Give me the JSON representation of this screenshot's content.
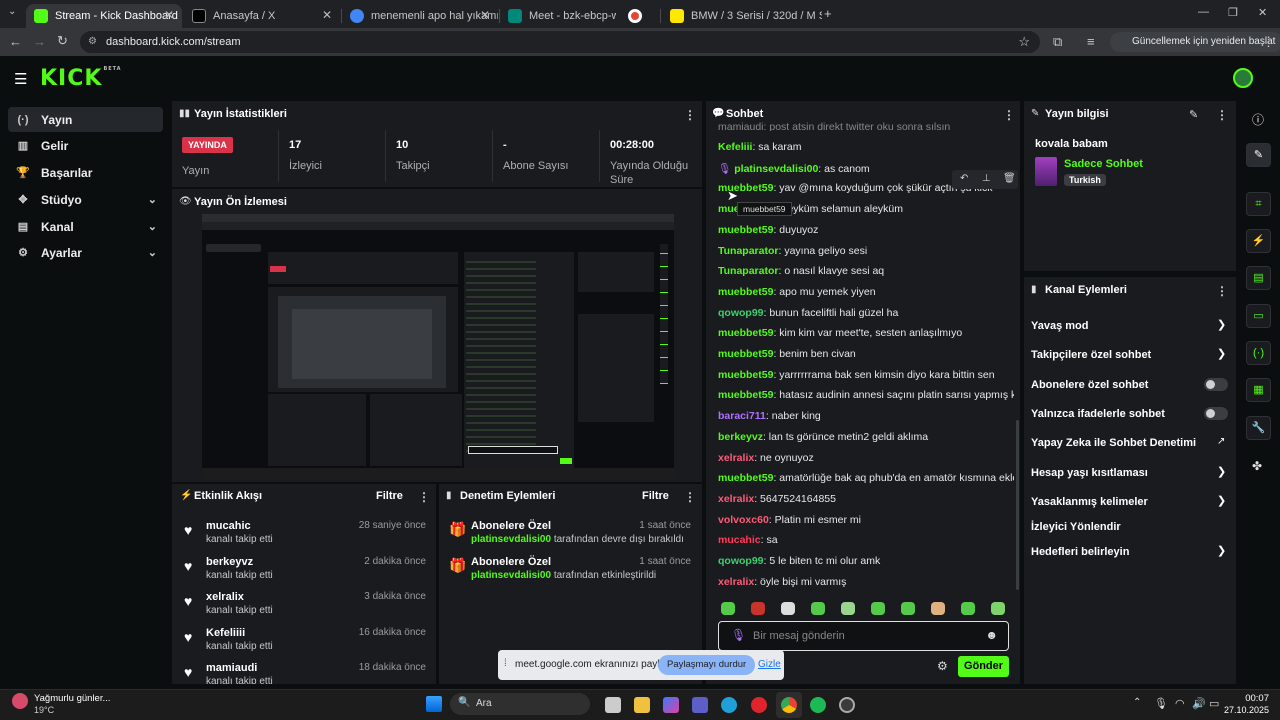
{
  "browser": {
    "tabs": [
      {
        "title": "Stream - Kick Dashboard",
        "color": "#53fc18"
      },
      {
        "title": "Anasayfa / X",
        "color": "#000000"
      },
      {
        "title": "menemenli apo hal yıkamı - Go",
        "color": "#4285f4"
      },
      {
        "title": "Meet - bzk-ebcp-wnt",
        "color": "#00897b"
      },
      {
        "title": "",
        "color": "#ea4335"
      },
      {
        "title": "BMW / 3 Serisi / 320d / M Spo",
        "color": "#ffe800"
      }
    ],
    "url": "dashboard.kick.com/stream",
    "update_button": "Güncellemek için yeniden başlat"
  },
  "kick": {
    "logo": "KICK",
    "logo_tag": "BETA"
  },
  "sidebar": {
    "items": [
      {
        "label": "Yayın",
        "icon": "broadcast-icon"
      },
      {
        "label": "Gelir",
        "icon": "chart-icon"
      },
      {
        "label": "Başarılar",
        "icon": "trophy-icon"
      },
      {
        "label": "Stüdyo",
        "icon": "studio-icon"
      },
      {
        "label": "Kanal",
        "icon": "channel-icon"
      },
      {
        "label": "Ayarlar",
        "icon": "gear-icon"
      }
    ]
  },
  "stats": {
    "title": "Yayın İstatistikleri",
    "live_badge": "YAYINDA",
    "live_label": "Yayın",
    "items": [
      {
        "value": "17",
        "label": "İzleyici"
      },
      {
        "value": "10",
        "label": "Takipçi"
      },
      {
        "value": "-",
        "label": "Abone Sayısı"
      },
      {
        "value": "00:28:00",
        "label": "Yayında Olduğu Süre"
      }
    ]
  },
  "preview": {
    "title": "Yayın Ön İzlemesi"
  },
  "activity": {
    "title": "Etkinlik Akışı",
    "filter": "Filtre",
    "rows": [
      {
        "name": "mucahic",
        "text": "kanalı takip etti",
        "time": "28 saniye önce"
      },
      {
        "name": "berkeyvz",
        "text": "kanalı takip etti",
        "time": "2 dakika önce"
      },
      {
        "name": "xelralix",
        "text": "kanalı takip etti",
        "time": "3 dakika önce"
      },
      {
        "name": "Kefeliiii",
        "text": "kanalı takip etti",
        "time": "16 dakika önce"
      },
      {
        "name": "mamiaudi",
        "text": "kanalı takip etti",
        "time": "18 dakika önce"
      }
    ]
  },
  "moderation": {
    "title": "Denetim Eylemleri",
    "filter": "Filtre",
    "rows": [
      {
        "name": "Abonelere Özel",
        "user": "platinsevdalisi00",
        "text": "tarafından devre dışı bırakıldı",
        "time": "1 saat önce"
      },
      {
        "name": "Abonelere Özel",
        "user": "platinsevdalisi00",
        "text": "tarafından etkinleştirildi",
        "time": "1 saat önce"
      }
    ]
  },
  "chat": {
    "title": "Sohbet",
    "top_partial": "mamiaudi: post atsin direkt twitter oku sonra sılsın",
    "tooltip": "muebbet59",
    "messages": [
      {
        "user": "Kefeliii",
        "color": "#53fc18",
        "text": "sa karam"
      },
      {
        "user": "platinsevdalisi00",
        "color": "#53fc18",
        "text": "as canom"
      },
      {
        "user": "muebbet59",
        "color": "#53fc18",
        "text": "yav @mına koyduğum çok şükür açtın şu kick"
      },
      {
        "user": "muebbet59",
        "color": "#53fc18",
        "text": "aleyküm selamun aleyküm"
      },
      {
        "user": "muebbet59",
        "color": "#53fc18",
        "text": "duyuyoz"
      },
      {
        "user": "Tunaparator",
        "color": "#53fc18",
        "text": "yayına geliyo sesi"
      },
      {
        "user": "Tunaparator",
        "color": "#53fc18",
        "text": "o nasıl klavye sesi aq"
      },
      {
        "user": "muebbet59",
        "color": "#53fc18",
        "text": "apo mu yemek yiyen"
      },
      {
        "user": "qowop99",
        "color": "#3bd16f",
        "text": "bunun faceliftli hali güzel ha"
      },
      {
        "user": "muebbet59",
        "color": "#53fc18",
        "text": "kim kim var meet'te, sesten anlaşılmıyo"
      },
      {
        "user": "muebbet59",
        "color": "#53fc18",
        "text": "benim ben civan"
      },
      {
        "user": "muebbet59",
        "color": "#53fc18",
        "text": "yarrrrrrama bak sen kimsin diyo kara bittin sen"
      },
      {
        "user": "muebbet59",
        "color": "#53fc18",
        "text": "hatasız audinin annesi saçını platin sarısı yapmış kara"
      },
      {
        "user": "baraci711",
        "color": "#b070ff",
        "text": "naber king"
      },
      {
        "user": "berkeyvz",
        "color": "#53fc18",
        "text": "lan ts görünce metin2 geldi aklıma"
      },
      {
        "user": "xelralix",
        "color": "#ff5a78",
        "text": "ne oynuyoz"
      },
      {
        "user": "muebbet59",
        "color": "#53fc18",
        "text": "amatörlüğe bak aq phub'da en amatör kısmına eklemelik"
      },
      {
        "user": "xelralix",
        "color": "#ff5a78",
        "text": "5647524164855"
      },
      {
        "user": "volvoxc60",
        "color": "#ff5a78",
        "text": "Platin mi esmer mi"
      },
      {
        "user": "mucahic",
        "color": "#ff3a5a",
        "text": "sa"
      },
      {
        "user": "qowop99",
        "color": "#3bd16f",
        "text": "5 le biten tc mi olur amk"
      },
      {
        "user": "xelralix",
        "color": "#ff5a78",
        "text": "öyle bişi mi varmış"
      }
    ],
    "input_placeholder": "Bir mesaj gönderin",
    "send_label": "Gönder"
  },
  "stream_info": {
    "title": "Yayın bilgisi",
    "stream_title": "kovala babam",
    "category": "Sadece Sohbet",
    "tag": "Turkish"
  },
  "channel_actions": {
    "title": "Kanal Eylemleri",
    "rows": [
      {
        "label": "Yavaş mod",
        "control": "chevron"
      },
      {
        "label": "Takipçilere özel sohbet",
        "control": "chevron"
      },
      {
        "label": "Abonelere özel sohbet",
        "control": "toggle"
      },
      {
        "label": "Yalnızca ifadelerle sohbet",
        "control": "toggle"
      },
      {
        "label": "Yapay Zeka ile Sohbet Denetimi",
        "control": "external"
      },
      {
        "label": "Hesap yaşı kısıtlaması",
        "control": "chevron"
      },
      {
        "label": "Yasaklanmış kelimeler",
        "control": "chevron"
      },
      {
        "label": "İzleyici Yönlendir",
        "control": "none"
      },
      {
        "label": "Hedefleri belirleyin",
        "control": "chevron"
      }
    ]
  },
  "share_bar": {
    "text": "meet.google.com ekranınızı paylaşıyor.",
    "stop": "Paylaşmayı durdur",
    "hide": "Gizle"
  },
  "taskbar": {
    "weather_title": "Yağmurlu günler...",
    "weather_temp": "19°C",
    "search": "Ara",
    "time": "00:07",
    "date": "27.10.2025"
  }
}
